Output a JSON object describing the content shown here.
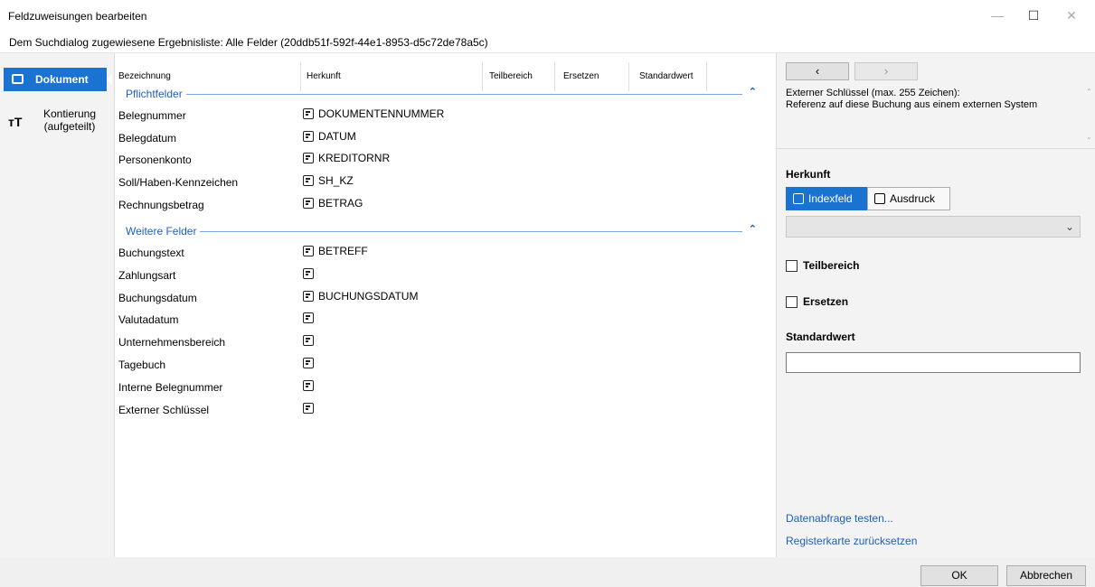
{
  "window": {
    "title": "Feldzuweisungen bearbeiten",
    "minimize": "—",
    "maximize": "☐",
    "close": "✕"
  },
  "subtitle": "Dem Suchdialog zugewiesene Ergebnisliste: Alle Felder (20ddb51f-592f-44e1-8953-d5c72de78a5c)",
  "sidebar": {
    "items": [
      {
        "label": "Dokument",
        "icon": "document-icon",
        "active": true
      },
      {
        "label": "Kontierung (aufgeteilt)",
        "icon": "text-size-icon",
        "active": false
      }
    ],
    "kont_icon_glyph": "ᴛT"
  },
  "table": {
    "columns": [
      "Bezeichnung",
      "Herkunft",
      "Teilbereich",
      "Ersetzen",
      "Standardwert"
    ],
    "groups": [
      {
        "title": "Pflichtfelder",
        "rows": [
          {
            "name": "Belegnummer",
            "source": "DOKUMENTENNUMMER"
          },
          {
            "name": "Belegdatum",
            "source": "DATUM"
          },
          {
            "name": "Personenkonto",
            "source": "KREDITORNR"
          },
          {
            "name": "Soll/Haben-Kennzeichen",
            "source": "SH_KZ"
          },
          {
            "name": "Rechnungsbetrag",
            "source": "BETRAG"
          }
        ]
      },
      {
        "title": "Weitere Felder",
        "rows": [
          {
            "name": "Buchungstext",
            "source": "BETREFF"
          },
          {
            "name": "Zahlungsart",
            "source": ""
          },
          {
            "name": "Buchungsdatum",
            "source": "BUCHUNGSDATUM"
          },
          {
            "name": "Valutadatum",
            "source": ""
          },
          {
            "name": "Unternehmensbereich",
            "source": ""
          },
          {
            "name": "Tagebuch",
            "source": ""
          },
          {
            "name": "Interne Belegnummer",
            "source": ""
          },
          {
            "name": "Externer Schlüssel",
            "source": ""
          }
        ]
      }
    ]
  },
  "detail": {
    "prev": "‹",
    "next": "›",
    "description_title": "Externer Schlüssel (max. 255 Zeichen):",
    "description_text": "Referenz auf diese Buchung aus einem externen System",
    "herkunft_label": "Herkunft",
    "seg_index": "Indexfeld",
    "seg_print": "Ausdruck",
    "combo_value": "",
    "teilbereich_label": "Teilbereich",
    "ersetzen_label": "Ersetzen",
    "standardwert_label": "Standardwert",
    "standardwert_value": "",
    "link_test": "Datenabfrage testen...",
    "link_reset": "Registerkarte zurücksetzen"
  },
  "footer": {
    "ok": "OK",
    "cancel": "Abbrechen"
  },
  "colors": {
    "accent": "#1a73d1",
    "link": "#1f5fbf"
  }
}
